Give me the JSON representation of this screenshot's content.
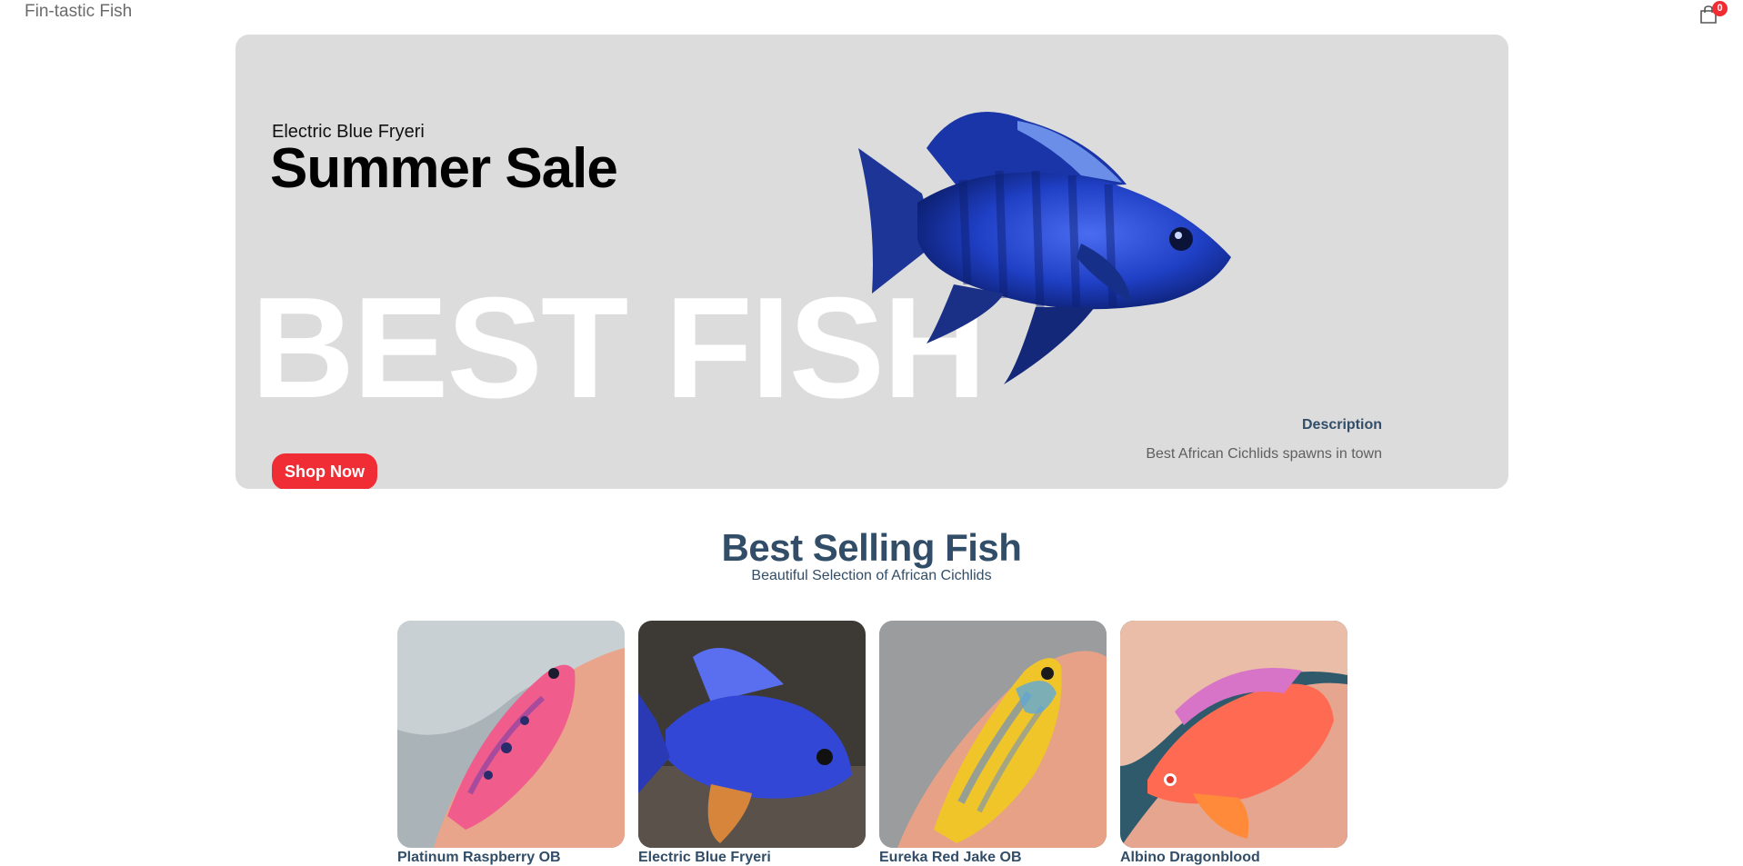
{
  "navbar": {
    "logo": "Fin-tastic Fish",
    "cart_count": "0",
    "cart_icon": "shopping-bag-icon",
    "accent_color": "#f02d34"
  },
  "hero": {
    "small_text": "Electric Blue Fryeri",
    "mid_text": "Summer Sale",
    "large_text": "BEST FISH",
    "button_label": "Shop Now",
    "description_title": "Description",
    "description_text": "Best African Cichlids spawns in town",
    "background_color": "#dcdcdc",
    "image": "electric-blue-fryeri-fish"
  },
  "best_selling": {
    "title": "Best Selling Fish",
    "subtitle": "Beautiful Selection of African Cichlids",
    "title_color": "#324d67",
    "products": [
      {
        "name": "Platinum Raspberry OB",
        "image": "platinum-raspberry-ob-fish"
      },
      {
        "name": "Electric Blue Fryeri",
        "image": "electric-blue-fryeri-fish"
      },
      {
        "name": "Eureka Red Jake OB",
        "image": "eureka-red-jake-ob-fish"
      },
      {
        "name": "Albino Dragonblood",
        "image": "albino-dragonblood-fish"
      }
    ]
  }
}
